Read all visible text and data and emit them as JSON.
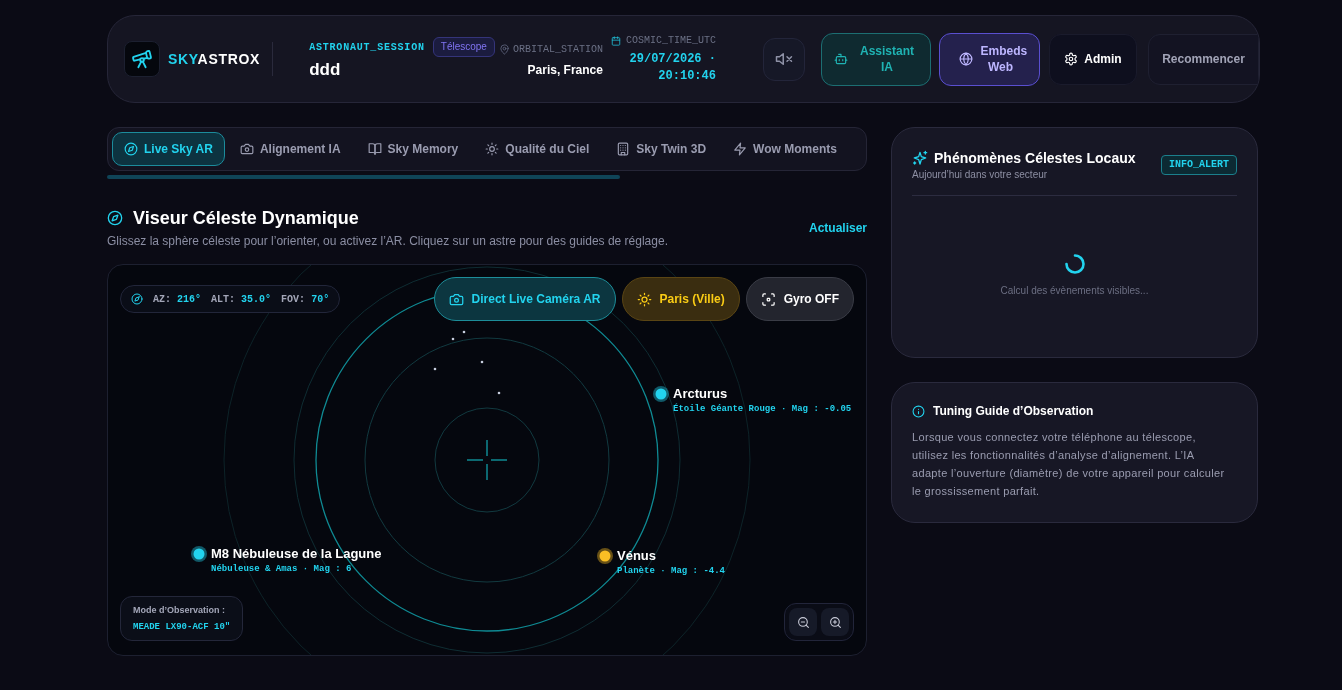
{
  "header": {
    "brand": {
      "accent": "SKY",
      "rest": "ASTROX"
    },
    "session": {
      "label": "ASTRONAUT_SESSION",
      "badge": "Télescope",
      "value": "ddd"
    },
    "station": {
      "label": "ORBITAL_STATION",
      "value": "Paris, France"
    },
    "clock": {
      "label": "COSMIC_TIME_UTC",
      "value": "29/07/2026 · 20:10:46"
    },
    "buttons": [
      {
        "kind": "icon",
        "muted": true
      },
      {
        "kind": "teal",
        "label": "Assistant IA"
      },
      {
        "kind": "violet",
        "label": "Embeds Web"
      },
      {
        "kind": "dark",
        "label": "Admin"
      },
      {
        "kind": "plain",
        "label": "Recommencer"
      }
    ]
  },
  "tabs": [
    {
      "label": "Live Sky AR",
      "selected": true
    },
    {
      "label": "Alignement IA",
      "selected": false
    },
    {
      "label": "Sky Memory",
      "selected": false
    },
    {
      "label": "Qualité du Ciel",
      "selected": false
    },
    {
      "label": "Sky Twin 3D",
      "selected": false
    },
    {
      "label": "Wow Moments",
      "selected": false
    }
  ],
  "viewer": {
    "title": "Viseur Céleste Dynamique",
    "subtitle": "Glissez la sphère céleste pour l’orienter, ou activez l’AR. Cliquez sur un astre pour des guides de réglage.",
    "action": "Actualiser",
    "readout": [
      {
        "label": "AZ:",
        "value": "216°"
      },
      {
        "label": "ALT:",
        "value": "35.0°"
      },
      {
        "label": "FOV:",
        "value": "70°"
      }
    ],
    "controls": [
      {
        "kind": "accent",
        "label": "Direct Live Caméra AR"
      },
      {
        "kind": "warm",
        "label": "Paris (Ville)"
      },
      {
        "kind": "neutral",
        "label": "Gyro OFF"
      }
    ],
    "objects": [
      {
        "name": "Arcturus",
        "detail": "Étoile Géante Rouge · Mag : -0.05",
        "color": "#22d3ee"
      },
      {
        "name": "M8 Nébuleuse de la Lagune",
        "detail": "Nébuleuse & Amas · Mag : 6",
        "color": "#22d3ee"
      },
      {
        "name": "Vénus",
        "detail": "Planète · Mag : -4.4",
        "color": "#fbbf24"
      }
    ],
    "mode": {
      "label": "Mode d’Observation :",
      "value": "MEADE LX90-ACF 10\""
    }
  },
  "events": {
    "title": "Phénomènes Célestes Locaux",
    "subtitle": "Aujourd’hui dans votre secteur",
    "badge": "INFO_ALERT",
    "loading": true,
    "status": "Calcul des évènements visibles..."
  },
  "guide": {
    "title": "Tuning Guide d’Observation",
    "text": "Lorsque vous connectez votre téléphone au télescope, utilisez les fonctionnalités d’analyse d’alignement. L’IA adapte l’ouverture (diamètre) de votre appareil pour calculer le grossissement parfait."
  }
}
